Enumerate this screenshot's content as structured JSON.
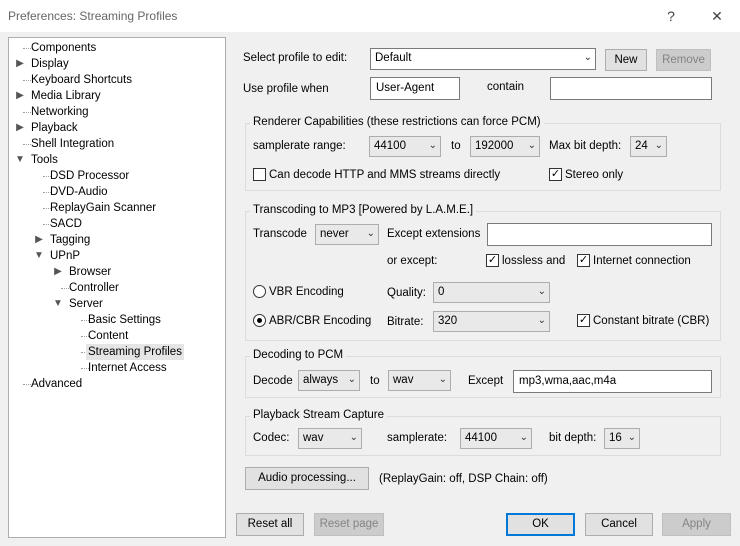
{
  "window": {
    "title": "Preferences: Streaming Profiles",
    "help_glyph": "?",
    "close_glyph": "✕"
  },
  "tree": {
    "components": "Components",
    "display": "Display",
    "keyboard_shortcuts": "Keyboard Shortcuts",
    "media_library": "Media Library",
    "networking": "Networking",
    "playback": "Playback",
    "shell_integration": "Shell Integration",
    "tools": "Tools",
    "dsd_processor": "DSD Processor",
    "dvd_audio": "DVD-Audio",
    "replaygain_scanner": "ReplayGain Scanner",
    "sacd": "SACD",
    "tagging": "Tagging",
    "upnp": "UPnP",
    "browser": "Browser",
    "controller": "Controller",
    "server": "Server",
    "basic_settings": "Basic Settings",
    "content": "Content",
    "streaming_profiles": "Streaming Profiles",
    "internet_access": "Internet Access",
    "advanced": "Advanced"
  },
  "profile": {
    "select_label": "Select profile to edit:",
    "selected": "Default",
    "new_button": "New",
    "remove_button": "Remove",
    "use_when_label": "Use profile when",
    "use_when_value": "User-Agent",
    "contain_label": "contain",
    "contain_value": ""
  },
  "renderer": {
    "title": "Renderer Capabilities (these restrictions can force PCM)",
    "samplerate_label": "samplerate range:",
    "samplerate_from": "44100",
    "to_label": "to",
    "samplerate_to": "192000",
    "max_bit_depth_label": "Max bit depth:",
    "max_bit_depth": "24",
    "can_decode_label": "Can decode  HTTP and MMS  streams directly",
    "can_decode_checked": false,
    "stereo_only_label": "Stereo only",
    "stereo_only_checked": true
  },
  "transcoding": {
    "title": "Transcoding to MP3 [Powered by L.A.M.E.]",
    "transcode_label": "Transcode",
    "transcode_value": "never",
    "except_ext_label": "Except extensions",
    "except_ext_value": "",
    "or_except_label": "or except:",
    "lossless_label": "lossless and",
    "lossless_checked": true,
    "internet_label": "Internet connection",
    "internet_checked": true,
    "vbr_label": "VBR Encoding",
    "vbr_selected": false,
    "quality_label": "Quality:",
    "quality_value": "0",
    "abr_label": "ABR/CBR Encoding",
    "abr_selected": true,
    "bitrate_label": "Bitrate:",
    "bitrate_value": "320",
    "constant_label": "Constant bitrate (CBR)",
    "constant_checked": true
  },
  "decoding": {
    "title": "Decoding to PCM",
    "decode_label": "Decode",
    "decode_value": "always",
    "to_label": "to",
    "format_value": "wav",
    "except_label": "Except",
    "except_value": "mp3,wma,aac,m4a"
  },
  "capture": {
    "title": "Playback Stream Capture",
    "codec_label": "Codec:",
    "codec_value": "wav",
    "samplerate_label": "samplerate:",
    "samplerate_value": "44100",
    "bit_depth_label": "bit depth:",
    "bit_depth_value": "16"
  },
  "audio_processing": {
    "button": "Audio processing...",
    "status": "(ReplayGain: off, DSP Chain: off)"
  },
  "footer": {
    "reset_all": "Reset all",
    "reset_page": "Reset page",
    "ok": "OK",
    "cancel": "Cancel",
    "apply": "Apply"
  },
  "icons": {
    "dropdown": "chevron-down-icon",
    "collapsed": "chevron-right-icon",
    "expanded": "chevron-down-icon",
    "check": "check-icon"
  },
  "colors": {
    "accent": "#0078d7",
    "selection": "#e5e5e5",
    "window_bg": "#f0f0f0"
  }
}
